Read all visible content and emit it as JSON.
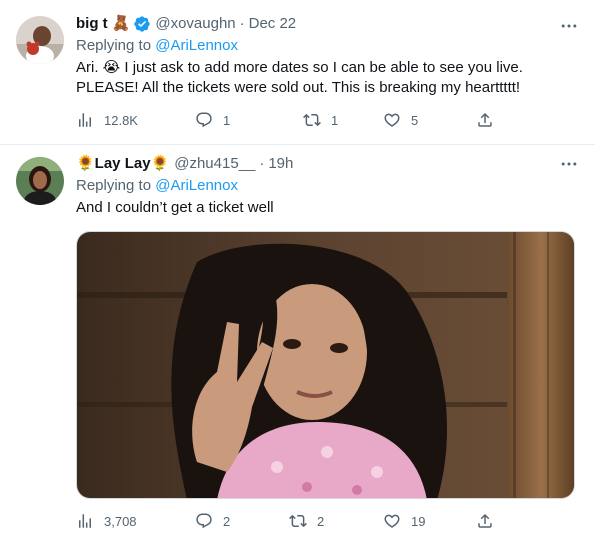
{
  "tweets": [
    {
      "display_name": "big t",
      "name_emoji": "🧸",
      "handle": "@xovaughn",
      "separator": "·",
      "date": "Dec 22",
      "replying_prefix": "Replying to ",
      "replying_to": "@AriLennox",
      "text_line1": "Ari. 😭 I just ask to add more dates so I can be able to see you live.",
      "text_line2": "PLEASE! All the tickets were sold out. This is breaking my hearttttt!",
      "views": "12.8K",
      "replies": "1",
      "retweets": "1",
      "likes": "5"
    },
    {
      "display_name": "🌻Lay Lay🌻",
      "handle": "@zhu415__",
      "separator": "·",
      "date": "19h",
      "replying_prefix": "Replying to ",
      "replying_to": "@AriLennox",
      "text_line1": "And I couldn’t get a ticket well",
      "views": "3,708",
      "replies": "2",
      "retweets": "2",
      "likes": "19"
    }
  ],
  "icons": {
    "views": "bar-chart-icon",
    "reply": "speech-bubble-icon",
    "retweet": "retweet-arrows-icon",
    "like": "heart-icon",
    "share": "share-upload-icon",
    "more": "ellipsis-icon",
    "verified": "verified-badge-icon"
  },
  "colors": {
    "accent": "#1d9bf0",
    "secondary_text": "#536471",
    "primary_text": "#0f1419"
  }
}
